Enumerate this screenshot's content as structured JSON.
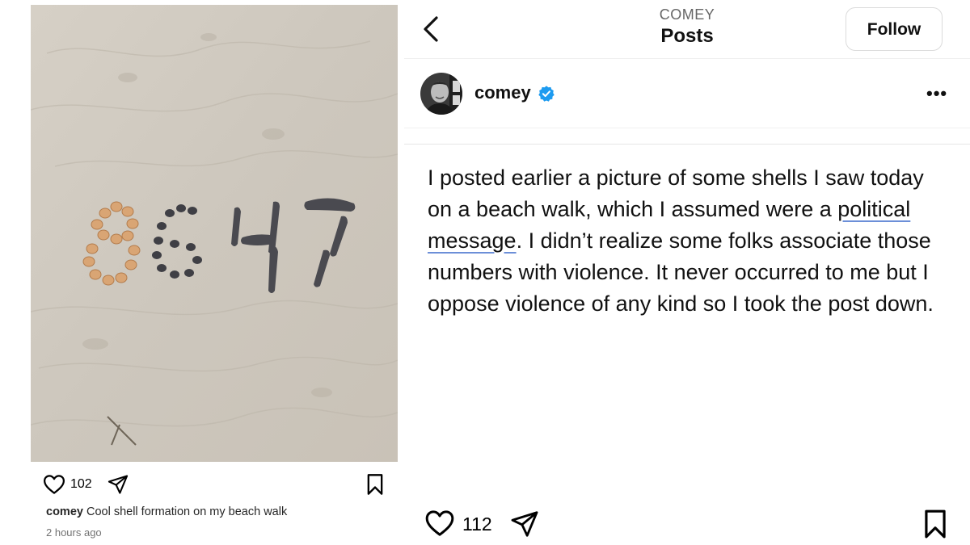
{
  "left_post": {
    "photo_text": "8647",
    "likes": "102",
    "caption_user": "comey",
    "caption_text": " Cool shell formation on my beach walk",
    "time": "2 hours ago"
  },
  "header": {
    "username": "COMEY",
    "title": "Posts",
    "follow_label": "Follow"
  },
  "profile": {
    "username": "comey",
    "more_label": "•••"
  },
  "post": {
    "segments": [
      "I posted earlier a picture of some shells I saw today on a beach walk, which I assumed were a ",
      "political",
      " ",
      "message",
      ". I didn’t realize some folks associate those numbers with violence. It never occurred to me but I oppose violence of any kind so I took the post down."
    ],
    "likes": "112"
  },
  "colors": {
    "verified": "#1d9bf0",
    "underline": "#6c8fd8",
    "sand": "#cfc9bf"
  },
  "icons": [
    "heart-icon",
    "paper-plane-icon",
    "bookmark-icon",
    "chevron-left-icon",
    "verified-icon",
    "more-icon"
  ]
}
